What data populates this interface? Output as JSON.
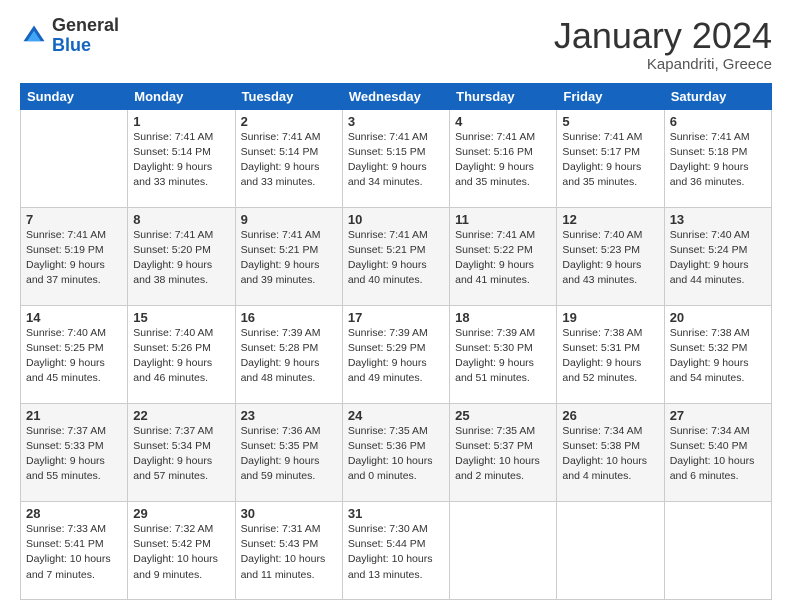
{
  "header": {
    "logo": {
      "general": "General",
      "blue": "Blue"
    },
    "title": "January 2024",
    "location": "Kapandriti, Greece"
  },
  "calendar": {
    "headers": [
      "Sunday",
      "Monday",
      "Tuesday",
      "Wednesday",
      "Thursday",
      "Friday",
      "Saturday"
    ],
    "weeks": [
      [
        {
          "day": "",
          "info": ""
        },
        {
          "day": "1",
          "info": "Sunrise: 7:41 AM\nSunset: 5:14 PM\nDaylight: 9 hours\nand 33 minutes."
        },
        {
          "day": "2",
          "info": "Sunrise: 7:41 AM\nSunset: 5:14 PM\nDaylight: 9 hours\nand 33 minutes."
        },
        {
          "day": "3",
          "info": "Sunrise: 7:41 AM\nSunset: 5:15 PM\nDaylight: 9 hours\nand 34 minutes."
        },
        {
          "day": "4",
          "info": "Sunrise: 7:41 AM\nSunset: 5:16 PM\nDaylight: 9 hours\nand 35 minutes."
        },
        {
          "day": "5",
          "info": "Sunrise: 7:41 AM\nSunset: 5:17 PM\nDaylight: 9 hours\nand 35 minutes."
        },
        {
          "day": "6",
          "info": "Sunrise: 7:41 AM\nSunset: 5:18 PM\nDaylight: 9 hours\nand 36 minutes."
        }
      ],
      [
        {
          "day": "7",
          "info": "Sunrise: 7:41 AM\nSunset: 5:19 PM\nDaylight: 9 hours\nand 37 minutes."
        },
        {
          "day": "8",
          "info": "Sunrise: 7:41 AM\nSunset: 5:20 PM\nDaylight: 9 hours\nand 38 minutes."
        },
        {
          "day": "9",
          "info": "Sunrise: 7:41 AM\nSunset: 5:21 PM\nDaylight: 9 hours\nand 39 minutes."
        },
        {
          "day": "10",
          "info": "Sunrise: 7:41 AM\nSunset: 5:21 PM\nDaylight: 9 hours\nand 40 minutes."
        },
        {
          "day": "11",
          "info": "Sunrise: 7:41 AM\nSunset: 5:22 PM\nDaylight: 9 hours\nand 41 minutes."
        },
        {
          "day": "12",
          "info": "Sunrise: 7:40 AM\nSunset: 5:23 PM\nDaylight: 9 hours\nand 43 minutes."
        },
        {
          "day": "13",
          "info": "Sunrise: 7:40 AM\nSunset: 5:24 PM\nDaylight: 9 hours\nand 44 minutes."
        }
      ],
      [
        {
          "day": "14",
          "info": "Sunrise: 7:40 AM\nSunset: 5:25 PM\nDaylight: 9 hours\nand 45 minutes."
        },
        {
          "day": "15",
          "info": "Sunrise: 7:40 AM\nSunset: 5:26 PM\nDaylight: 9 hours\nand 46 minutes."
        },
        {
          "day": "16",
          "info": "Sunrise: 7:39 AM\nSunset: 5:28 PM\nDaylight: 9 hours\nand 48 minutes."
        },
        {
          "day": "17",
          "info": "Sunrise: 7:39 AM\nSunset: 5:29 PM\nDaylight: 9 hours\nand 49 minutes."
        },
        {
          "day": "18",
          "info": "Sunrise: 7:39 AM\nSunset: 5:30 PM\nDaylight: 9 hours\nand 51 minutes."
        },
        {
          "day": "19",
          "info": "Sunrise: 7:38 AM\nSunset: 5:31 PM\nDaylight: 9 hours\nand 52 minutes."
        },
        {
          "day": "20",
          "info": "Sunrise: 7:38 AM\nSunset: 5:32 PM\nDaylight: 9 hours\nand 54 minutes."
        }
      ],
      [
        {
          "day": "21",
          "info": "Sunrise: 7:37 AM\nSunset: 5:33 PM\nDaylight: 9 hours\nand 55 minutes."
        },
        {
          "day": "22",
          "info": "Sunrise: 7:37 AM\nSunset: 5:34 PM\nDaylight: 9 hours\nand 57 minutes."
        },
        {
          "day": "23",
          "info": "Sunrise: 7:36 AM\nSunset: 5:35 PM\nDaylight: 9 hours\nand 59 minutes."
        },
        {
          "day": "24",
          "info": "Sunrise: 7:35 AM\nSunset: 5:36 PM\nDaylight: 10 hours\nand 0 minutes."
        },
        {
          "day": "25",
          "info": "Sunrise: 7:35 AM\nSunset: 5:37 PM\nDaylight: 10 hours\nand 2 minutes."
        },
        {
          "day": "26",
          "info": "Sunrise: 7:34 AM\nSunset: 5:38 PM\nDaylight: 10 hours\nand 4 minutes."
        },
        {
          "day": "27",
          "info": "Sunrise: 7:34 AM\nSunset: 5:40 PM\nDaylight: 10 hours\nand 6 minutes."
        }
      ],
      [
        {
          "day": "28",
          "info": "Sunrise: 7:33 AM\nSunset: 5:41 PM\nDaylight: 10 hours\nand 7 minutes."
        },
        {
          "day": "29",
          "info": "Sunrise: 7:32 AM\nSunset: 5:42 PM\nDaylight: 10 hours\nand 9 minutes."
        },
        {
          "day": "30",
          "info": "Sunrise: 7:31 AM\nSunset: 5:43 PM\nDaylight: 10 hours\nand 11 minutes."
        },
        {
          "day": "31",
          "info": "Sunrise: 7:30 AM\nSunset: 5:44 PM\nDaylight: 10 hours\nand 13 minutes."
        },
        {
          "day": "",
          "info": ""
        },
        {
          "day": "",
          "info": ""
        },
        {
          "day": "",
          "info": ""
        }
      ]
    ]
  }
}
